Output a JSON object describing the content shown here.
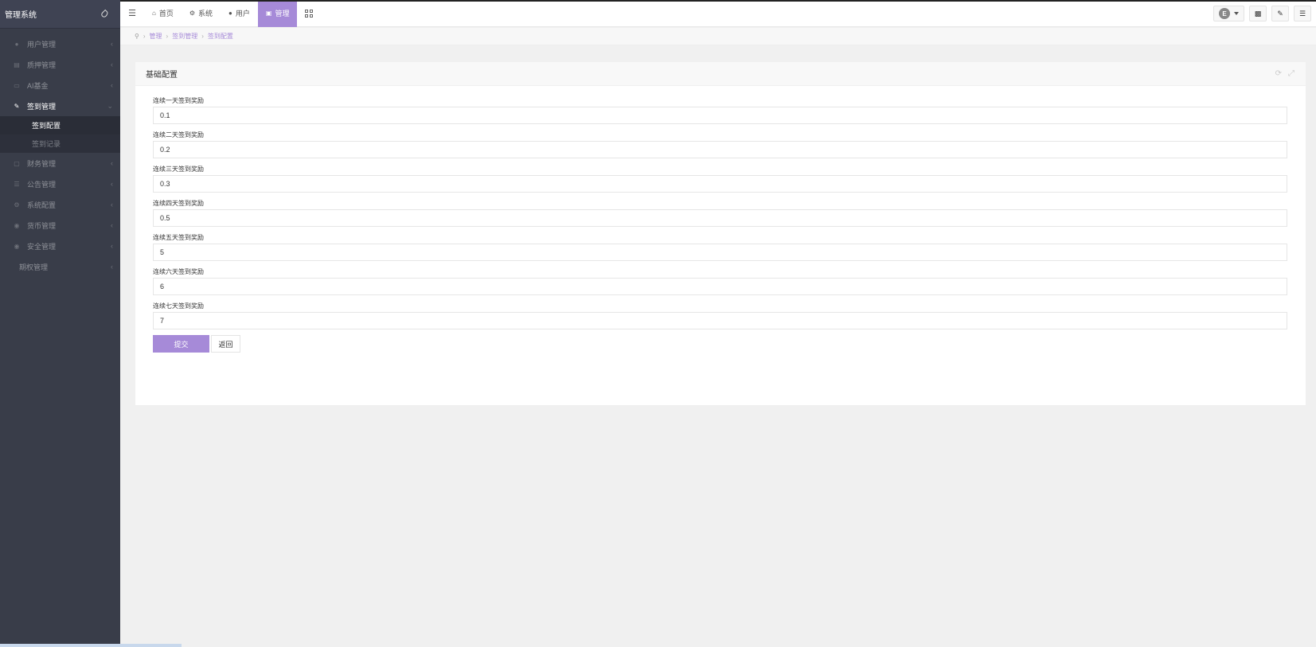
{
  "sidebar": {
    "brand": "管理系统",
    "menu": [
      {
        "label": "用户管理",
        "icon": "user-icon"
      },
      {
        "label": "质押管理",
        "icon": "card-icon"
      },
      {
        "label": "AI基金",
        "icon": "monitor-icon"
      },
      {
        "label": "签到管理",
        "icon": "edit-icon",
        "open": true
      },
      {
        "label": "财务管理",
        "icon": "money-icon"
      },
      {
        "label": "公告管理",
        "icon": "list-icon"
      },
      {
        "label": "系统配置",
        "icon": "settings-icon"
      },
      {
        "label": "货币管理",
        "icon": "coin-icon"
      },
      {
        "label": "安全管理",
        "icon": "lock-icon"
      },
      {
        "label": "期权管理",
        "icon": ""
      }
    ],
    "submenu": [
      {
        "label": "签到配置",
        "active": true
      },
      {
        "label": "签到记录",
        "active": false
      }
    ]
  },
  "topbar": {
    "tabs": [
      {
        "label": "首页",
        "icon": "home-icon"
      },
      {
        "label": "系统",
        "icon": "gear-icon"
      },
      {
        "label": "用户",
        "icon": "user-icon"
      },
      {
        "label": "管理",
        "icon": "bag-icon",
        "active": true
      }
    ],
    "avatar_letter": "E"
  },
  "breadcrumb": [
    "管理",
    "签到管理",
    "签到配置"
  ],
  "panel": {
    "title": "基础配置",
    "fields": [
      {
        "label": "连续一天签到奖励",
        "value": "0.1"
      },
      {
        "label": "连续二天签到奖励",
        "value": "0.2"
      },
      {
        "label": "连续三天签到奖励",
        "value": "0.3"
      },
      {
        "label": "连续四天签到奖励",
        "value": "0.5"
      },
      {
        "label": "连续五天签到奖励",
        "value": "5"
      },
      {
        "label": "连续六天签到奖励",
        "value": "6"
      },
      {
        "label": "连续七天签到奖励",
        "value": "7"
      }
    ],
    "submit_label": "提交",
    "back_label": "返回"
  },
  "colors": {
    "accent": "#a68ad8",
    "sidebar_bg": "#393d49"
  }
}
